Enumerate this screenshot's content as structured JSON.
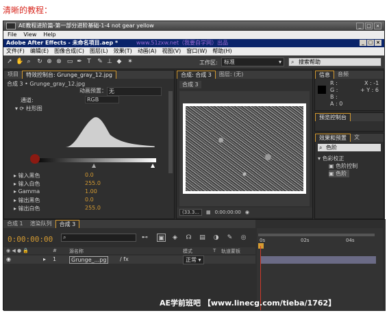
{
  "caption": "清晰的教程：",
  "player": {
    "title": "AE教程进阶篇-第一部分进阶基础-1-4 not gear yellow",
    "menu": [
      "File",
      "View",
      "Help"
    ]
  },
  "ae": {
    "title": "Adobe After Effects - 未命名项目.aep *",
    "watermark": "www.51zxw.net（我要自学网）出品",
    "menu": [
      "文件(F)",
      "编辑(E)",
      "图像合成(C)",
      "图层(L)",
      "效果(T)",
      "动画(A)",
      "视图(V)",
      "窗口(W)",
      "帮助(H)"
    ],
    "workspace_label": "工作区:",
    "workspace_value": "标准",
    "search_placeholder": "搜索帮助"
  },
  "effects_panel": {
    "tabs": [
      "项目",
      "特效控制台: Grunge_gray_12.jpg"
    ],
    "layer_path": "合成 3 • Grunge_gray_12.jpg",
    "preset_label": "动画预置：",
    "preset_value": "无",
    "channel_label": "通道:",
    "channel_value": "RGB",
    "histogram_label": "柱形图",
    "params": [
      {
        "label": "输入黑色",
        "value": "0.0"
      },
      {
        "label": "输入白色",
        "value": "255.0"
      },
      {
        "label": "Gamma",
        "value": "1.00"
      },
      {
        "label": "输出黑色",
        "value": "0.0"
      },
      {
        "label": "输出白色",
        "value": "255.0"
      }
    ]
  },
  "comp_panel": {
    "tabs": [
      "合成: 合成 3",
      "图层: (无)"
    ],
    "subtab": "合成 3",
    "zoom": "(33.3...",
    "timecode": "0:00:00:00"
  },
  "info_panel": {
    "tabs": [
      "信息",
      "音频"
    ],
    "rgb": [
      "R :",
      "G :",
      "B :",
      "A : 0"
    ],
    "xy": [
      "X : -1",
      "+ Y : 6"
    ]
  },
  "preview_panel": {
    "title": "预览控制台"
  },
  "effects_presets": {
    "tabs": [
      "效果和预置",
      "文"
    ],
    "search_value": "色阶",
    "group": "色彩校正",
    "items": [
      "色阶控制",
      "色阶"
    ]
  },
  "timeline": {
    "tabs": [
      "合成 1",
      "渲染队列",
      "合成 3"
    ],
    "time": "0:00:00:00",
    "columns": [
      "#",
      "源名称",
      "模式",
      "T",
      "轨道蒙板"
    ],
    "row": {
      "num": "1",
      "name": "Grunge_...pg",
      "mode": "正常"
    },
    "ruler": [
      "0s",
      "02s",
      "04s"
    ]
  },
  "bottom_watermark": "AE学前班吧 【www.linecg.com/tieba/1762】"
}
